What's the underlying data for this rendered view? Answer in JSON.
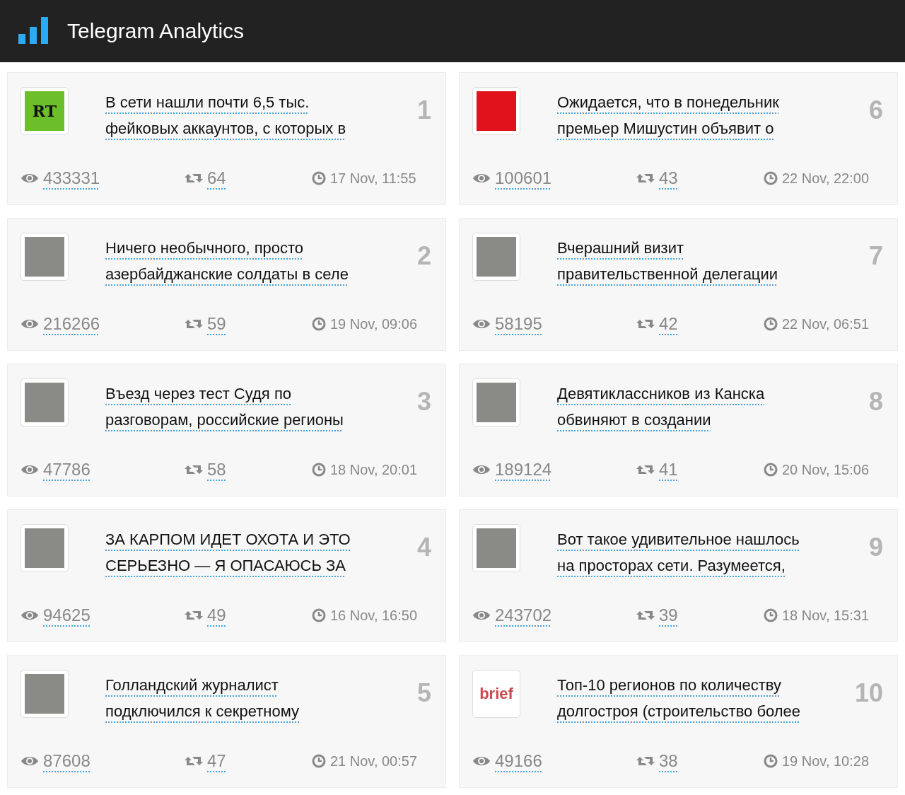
{
  "header": {
    "title": "Telegram Analytics"
  },
  "posts": [
    {
      "rank": "1",
      "avatar": {
        "kind": "logo",
        "text": "RT",
        "color": "#6cbf2a"
      },
      "title": [
        "В сети нашли почти 6,5 тыс.",
        "фейковых аккаунтов, с которых в"
      ],
      "views": "433331",
      "reposts": "64",
      "date": "17 Nov, 11:55"
    },
    {
      "rank": "2",
      "avatar": {
        "kind": "photo"
      },
      "title": [
        "Ничего необычного, просто",
        "азербайджанские солдаты в селе"
      ],
      "views": "216266",
      "reposts": "59",
      "date": "19 Nov, 09:06"
    },
    {
      "rank": "3",
      "avatar": {
        "kind": "photo"
      },
      "title": [
        "Въезд через тест Судя по",
        "разговорам, российские регионы"
      ],
      "views": "47786",
      "reposts": "58",
      "date": "18 Nov, 20:01"
    },
    {
      "rank": "4",
      "avatar": {
        "kind": "photo"
      },
      "title": [
        "ЗА КАРПОМ ИДЕТ ОХОТА И ЭТО",
        "СЕРЬЕЗНО — Я ОПАСАЮСЬ ЗА"
      ],
      "views": "94625",
      "reposts": "49",
      "date": "16 Nov, 16:50"
    },
    {
      "rank": "5",
      "avatar": {
        "kind": "photo"
      },
      "title": [
        "Голландский журналист",
        "подключился к секретному"
      ],
      "views": "87608",
      "reposts": "47",
      "date": "21 Nov, 00:57"
    },
    {
      "rank": "6",
      "avatar": {
        "kind": "block",
        "color": "#e0121b"
      },
      "title": [
        "Ожидается, что в понедельник",
        "премьер Мишустин объявит о"
      ],
      "views": "100601",
      "reposts": "43",
      "date": "22 Nov, 22:00"
    },
    {
      "rank": "7",
      "avatar": {
        "kind": "photo"
      },
      "title": [
        "Вчерашний визит",
        "правительственной делегации"
      ],
      "views": "58195",
      "reposts": "42",
      "date": "22 Nov, 06:51"
    },
    {
      "rank": "8",
      "avatar": {
        "kind": "photo"
      },
      "title": [
        "Девятиклассников из Канска",
        "обвиняют в создании"
      ],
      "views": "189124",
      "reposts": "41",
      "date": "20 Nov, 15:06"
    },
    {
      "rank": "9",
      "avatar": {
        "kind": "photo"
      },
      "title": [
        "Вот такое удивительное нашлось",
        "на просторах сети. Разумеется,"
      ],
      "views": "243702",
      "reposts": "39",
      "date": "18 Nov, 15:31"
    },
    {
      "rank": "10",
      "avatar": {
        "kind": "logo",
        "text": "brief",
        "color": "#ffffff"
      },
      "title": [
        "Топ-10 регионов по количеству",
        "долгостроя (строительство более"
      ],
      "views": "49166",
      "reposts": "38",
      "date": "19 Nov, 10:28"
    }
  ]
}
